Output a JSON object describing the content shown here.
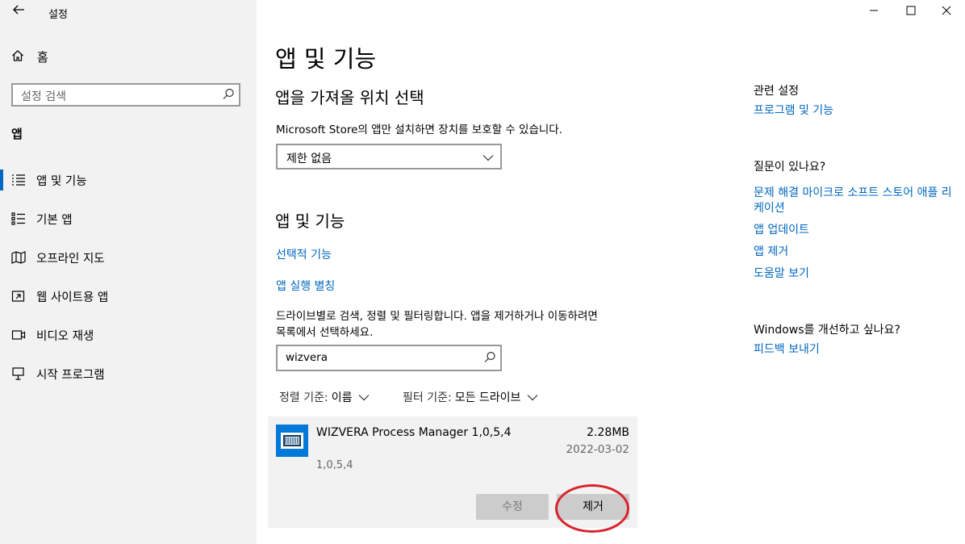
{
  "window": {
    "title": "설정",
    "controls": {
      "minimize": "—",
      "maximize": "☐",
      "close": "✕"
    }
  },
  "sidebar": {
    "home_label": "홈",
    "search_placeholder": "설정 검색",
    "section_label": "앱",
    "items": [
      {
        "label": "앱 및 기능",
        "icon": "apps-features-icon",
        "active": true
      },
      {
        "label": "기본 앱",
        "icon": "default-apps-icon",
        "active": false
      },
      {
        "label": "오프라인 지도",
        "icon": "offline-maps-icon",
        "active": false
      },
      {
        "label": "웹 사이트용 앱",
        "icon": "apps-for-websites-icon",
        "active": false
      },
      {
        "label": "비디오 재생",
        "icon": "video-playback-icon",
        "active": false
      },
      {
        "label": "시작 프로그램",
        "icon": "startup-icon",
        "active": false
      }
    ]
  },
  "main": {
    "page_title": "앱 및 기능",
    "install_section": {
      "heading": "앱을 가져올 위치 선택",
      "description": "Microsoft Store의 앱만 설치하면 장치를 보호할 수 있습니다.",
      "dropdown_value": "제한 없음"
    },
    "apps_section": {
      "heading": "앱 및 기능",
      "optional_features_link": "선택적 기능",
      "app_aliases_link": "앱 실행 별칭",
      "filter_description_line1": "드라이브별로 검색, 정렬 및 필터링합니다. 앱을 제거하거나 이동하려면",
      "filter_description_line2": "목록에서 선택하세요.",
      "search_value": "wizvera",
      "sort_label": "정렬 기준:",
      "sort_value": "이름",
      "filter_label": "필터 기준:",
      "filter_value": "모든 드라이브"
    },
    "app": {
      "name": "WIZVERA Process Manager 1,0,5,4",
      "size": "2.28MB",
      "date": "2022-03-02",
      "version": "1,0,5,4",
      "modify_label": "수정",
      "uninstall_label": "제거"
    }
  },
  "right_panel": {
    "related_heading": "관련 설정",
    "related_link": "프로그램 및 기능",
    "question_heading": "질문이 있나요?",
    "help_links": [
      "문제 해결 마이크로 소프트 스토어 애플 리케이션",
      "앱 업데이트",
      "앱 제거",
      "도움말 보기"
    ],
    "feedback_heading": "Windows를 개선하고 싶나요?",
    "feedback_link": "피드백 보내기"
  },
  "colors": {
    "accent": "#0067c0",
    "sidebar_bg": "#f2f2f2",
    "annotation_circle": "#d9232d",
    "app_icon": "#0078d7"
  }
}
